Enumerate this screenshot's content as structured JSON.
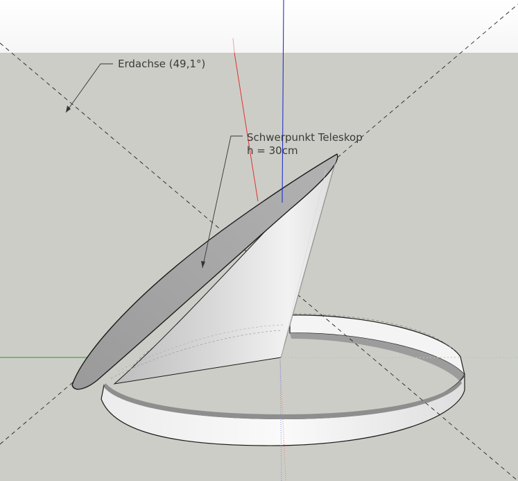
{
  "viewport": {
    "sky_color": "#ffffff",
    "ground_color": "#cdcdc7"
  },
  "axes": {
    "x_axis_color": "#e03030",
    "y_axis_color": "#20a020",
    "z_axis_color": "#2030d0"
  },
  "annotations": {
    "earth_axis_label": "Erdachse (49,1°)",
    "center_of_gravity_label": "Schwerpunkt Teleskop",
    "height_label": "h = 30cm"
  },
  "colors": {
    "cone_face": "#a6a6a6",
    "cone_side_light": "#e9e9e9",
    "cone_side_dark": "#bdbdbd",
    "ring_light": "#f5f5f5",
    "ring_shadow": "#9c9c9c",
    "edge": "#1a1a1a",
    "text": "#3a3a3a"
  }
}
